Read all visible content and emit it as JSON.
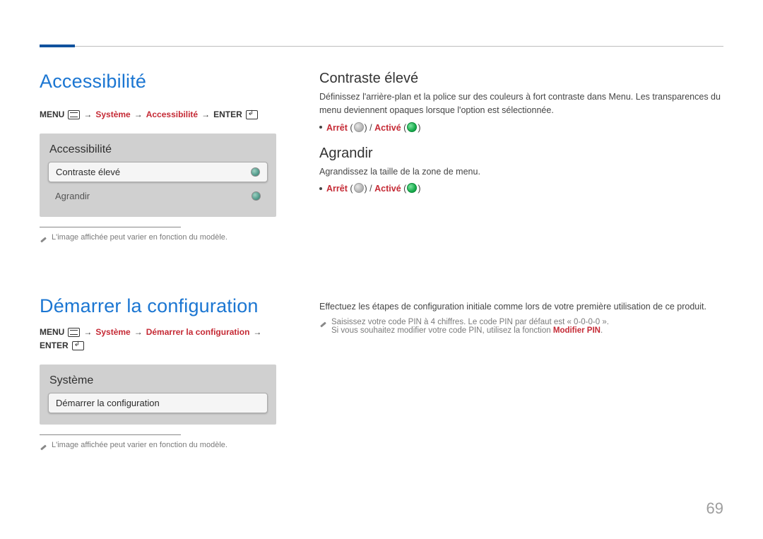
{
  "page_number": "69",
  "section1": {
    "title": "Accessibilité",
    "breadcrumb": {
      "menu": "MENU",
      "path1": "Système",
      "path2": "Accessibilité",
      "enter": "ENTER"
    },
    "panel": {
      "title": "Accessibilité",
      "item_selected": "Contraste élevé",
      "item2": "Agrandir"
    },
    "footnote": "L'image affichée peut varier en fonction du modèle.",
    "right": {
      "h_contrast": "Contraste élevé",
      "p_contrast": "Définissez l'arrière-plan et la police sur des couleurs à fort contraste dans Menu. Les transparences du menu deviennent opaques lorsque l'option est sélectionnée.",
      "opt_off": "Arrêt",
      "opt_on": "Activé",
      "h_enlarge": "Agrandir",
      "p_enlarge": "Agrandissez la taille de la zone de menu."
    }
  },
  "section2": {
    "title": "Démarrer la configuration",
    "breadcrumb": {
      "menu": "MENU",
      "path1": "Système",
      "path2": "Démarrer la configuration",
      "enter": "ENTER"
    },
    "panel": {
      "title": "Système",
      "item_selected": "Démarrer la configuration"
    },
    "footnote": "L'image affichée peut varier en fonction du modèle.",
    "right": {
      "p_main": "Effectuez les étapes de configuration initiale comme lors de votre première utilisation de ce produit.",
      "note1": "Saisissez votre code PIN à 4 chiffres. Le code PIN par défaut est « 0-0-0-0 ».",
      "note2_a": "Si vous souhaitez modifier votre code PIN, utilisez la fonction ",
      "note2_b": "Modifier PIN",
      "note2_c": "."
    }
  }
}
